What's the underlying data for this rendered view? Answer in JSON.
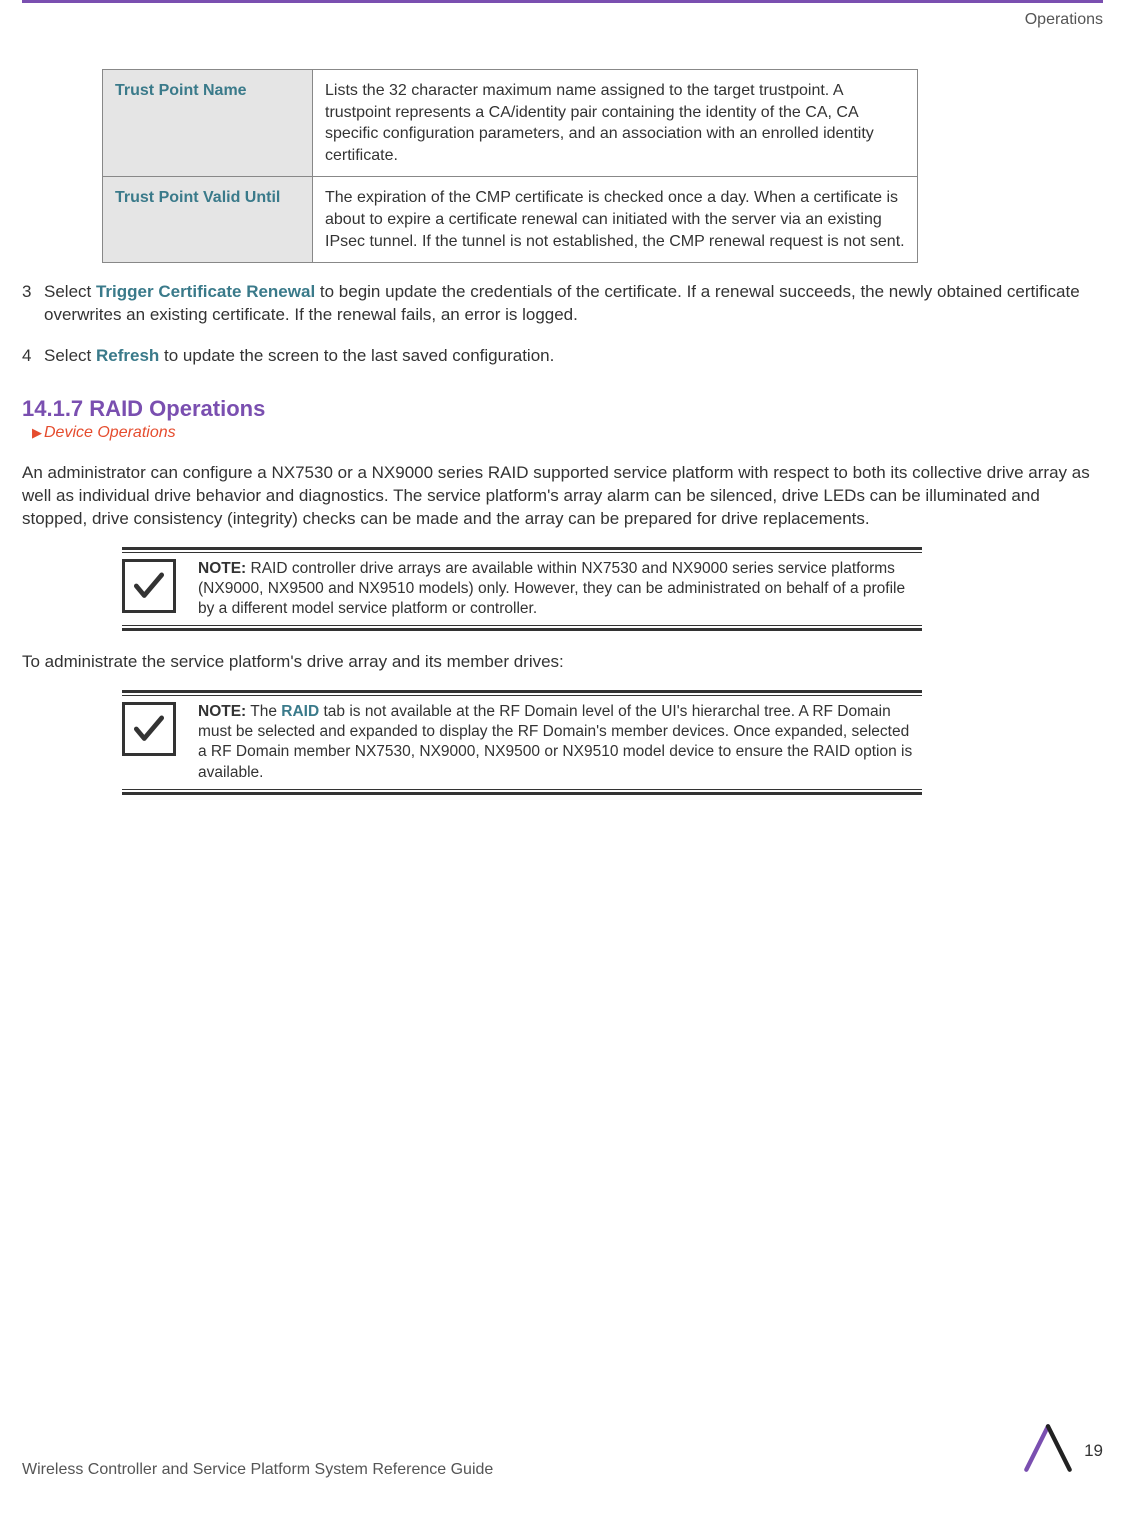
{
  "header": {
    "chapter": "Operations"
  },
  "table": {
    "rows": [
      {
        "label": "Trust Point Name",
        "desc": "Lists the 32 character maximum name assigned to the target trustpoint. A trustpoint represents a CA/identity pair containing the identity of the CA, CA specific configuration parameters, and an association with an enrolled identity certificate."
      },
      {
        "label": "Trust Point Valid Until",
        "desc": "The expiration of the CMP certificate is checked once a day. When a certificate is about to expire a certificate renewal can initiated with the server via an existing IPsec tunnel. If the tunnel is not established, the CMP renewal request is not sent."
      }
    ]
  },
  "steps": [
    {
      "num": "3",
      "prefix": "Select ",
      "action": "Trigger Certificate Renewal",
      "suffix": " to begin update the credentials of the certificate. If a renewal succeeds, the newly obtained certificate overwrites an existing certificate. If the renewal fails, an error is logged."
    },
    {
      "num": "4",
      "prefix": "Select ",
      "action": "Refresh",
      "suffix": " to update the screen to the last saved configuration."
    }
  ],
  "section": {
    "number": "14.1.7",
    "title": "RAID Operations",
    "breadcrumb": "Device Operations"
  },
  "paragraphs": {
    "intro": "An administrator can configure a NX7530 or a NX9000 series RAID supported service platform with respect to both its collective drive array as well as individual drive behavior and diagnostics. The service platform's array alarm can be silenced, drive LEDs can be illuminated and stopped, drive consistency (integrity) checks can be made and the array can be prepared for drive replacements.",
    "toAdmin": "To administrate the service platform's drive array and its member drives:"
  },
  "notes": [
    {
      "label": "NOTE:",
      "text": " RAID controller drive arrays are available within NX7530 and NX9000 series service platforms (NX9000, NX9500 and NX9510 models) only. However, they can be administrated on behalf of a profile by a different model service platform or controller."
    },
    {
      "label": "NOTE:",
      "prefix": " The ",
      "bold": "RAID",
      "suffix": " tab is not available at the RF Domain level of the UI's hierarchal tree. A RF Domain must be selected and expanded to display the RF Domain's member devices. Once expanded, selected a RF Domain member NX7530, NX9000, NX9500 or NX9510 model device to ensure the RAID option is available."
    }
  ],
  "footer": {
    "title": "Wireless Controller and Service Platform System Reference Guide",
    "page": "19"
  }
}
